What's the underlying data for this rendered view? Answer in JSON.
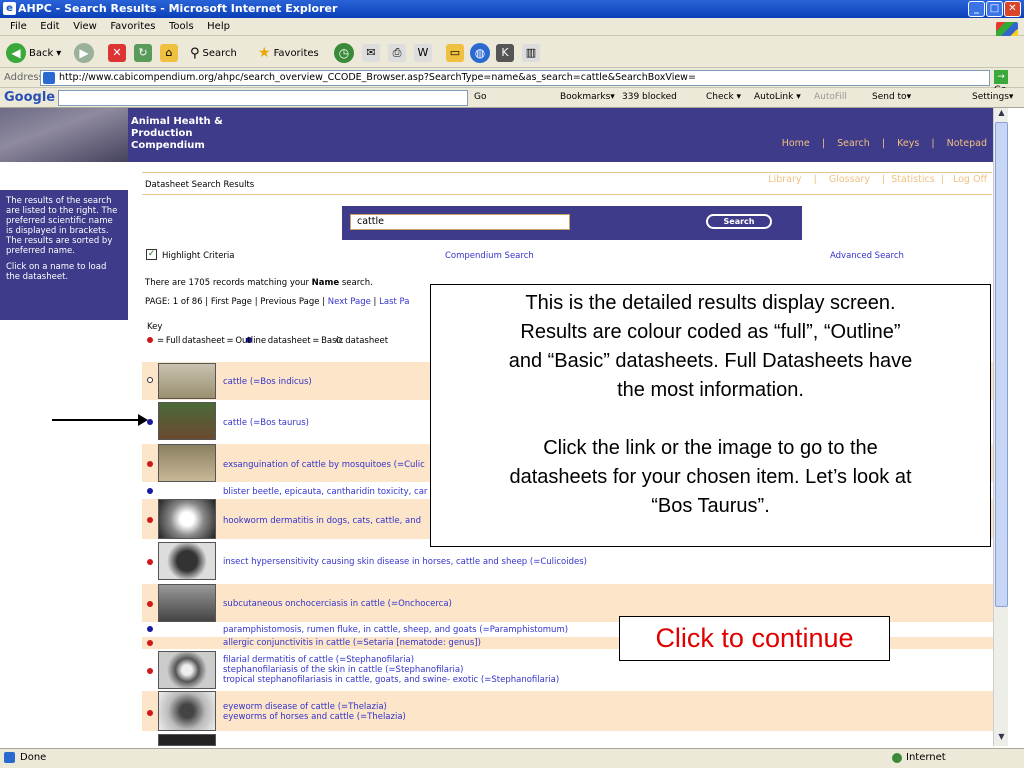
{
  "window": {
    "title": "AHPC - Search Results - Microsoft Internet Explorer",
    "controls": [
      "_",
      "□",
      "✕"
    ]
  },
  "menu": [
    "File",
    "Edit",
    "View",
    "Favorites",
    "Tools",
    "Help"
  ],
  "toolbar": {
    "back": "Back",
    "search": "Search",
    "favorites": "Favorites"
  },
  "address": {
    "label": "Address",
    "url": "http://www.cabicompendium.org/ahpc/search_overview_CCODE_Browser.asp?SearchType=name&as_search=cattle&SearchBoxView=",
    "go": "Go"
  },
  "googlebar": {
    "logo": "Google",
    "go": "Go",
    "bookmarks": "Bookmarks▾",
    "blocked": "339 blocked",
    "check": "Check ▾",
    "autolink": "AutoLink ▾",
    "autofill": "AutoFill",
    "sendto": "Send to▾",
    "settings": "Settings▾"
  },
  "banner": {
    "brand_line1": "Animal Health &",
    "brand_line2": "Production",
    "brand_line3": "Compendium",
    "nav_row1": "Home    |    Search    |    Keys    |    Notepad",
    "nav_row2": "Library    |    Glossary    |  Statistics  |   Log Off"
  },
  "sidebar": {
    "text1": "The results of the search are listed to the right. The preferred scientific name is displayed in brackets. The results are sorted by preferred name.",
    "text2": "Click on a name to load the datasheet."
  },
  "main": {
    "heading": "Datasheet Search Results",
    "search_value": "cattle",
    "search_button": "Search",
    "highlight": "Highlight Criteria",
    "compendium_search": "Compendium Search",
    "advanced_search": "Advanced Search",
    "records_prefix": "There are 1705 records matching your ",
    "records_bold": "Name",
    "records_suffix": " search.",
    "page_label": "PAGE: 1 of 86 | First Page | Previous Page | ",
    "next_page": "Next Page",
    "sep": " | ",
    "last_page": "Last Pa",
    "key_label": "Key",
    "key_legend": "= Full datasheet      = Outline datasheet     = Basic datasheet"
  },
  "results": [
    "cattle (=Bos indicus)",
    "cattle (=Bos taurus)",
    "exsanguination of cattle by mosquitoes (=Culic",
    "blister beetle, epicauta, cantharidin toxicity, car",
    "hookworm dermatitis in dogs, cats, cattle, and",
    "insect hypersensitivity causing skin disease in horses, cattle and sheep (=Culicoides)",
    "subcutaneous onchocerciasis in cattle (=Onchocerca)",
    "paramphistomosis, rumen fluke, in cattle, sheep, and goats (=Paramphistomum)",
    "allergic conjunctivitis in cattle (=Setaria [nematode: genus])",
    "filarial dermatitis of cattle (=Stephanofilaria)",
    "stephanofilariasis of the skin in cattle (=Stephanofilaria)",
    "tropical stephanofilariasis in cattle, goats, and swine- exotic (=Stephanofilaria)",
    "eyeworm disease of cattle (=Thelazia)",
    "eyeworms of horses and cattle (=Thelazia)"
  ],
  "callout": {
    "line1": "This is the detailed results display screen.",
    "line2": "Results are colour coded as “full”, “Outline”",
    "line3": "and “Basic” datasheets.  Full Datasheets have",
    "line4": "the most information.",
    "line5": "Click the link or the image to go to the",
    "line6": "datasheets for your chosen item. Let’s look at",
    "line7": "“Bos Taurus”."
  },
  "continue_label": "Click to continue",
  "status": {
    "left": "Done",
    "right": "Internet"
  },
  "colors": {
    "banner": "#3e3b8a",
    "row_shade": "#fce5c8",
    "callout_red": "#e00000"
  }
}
